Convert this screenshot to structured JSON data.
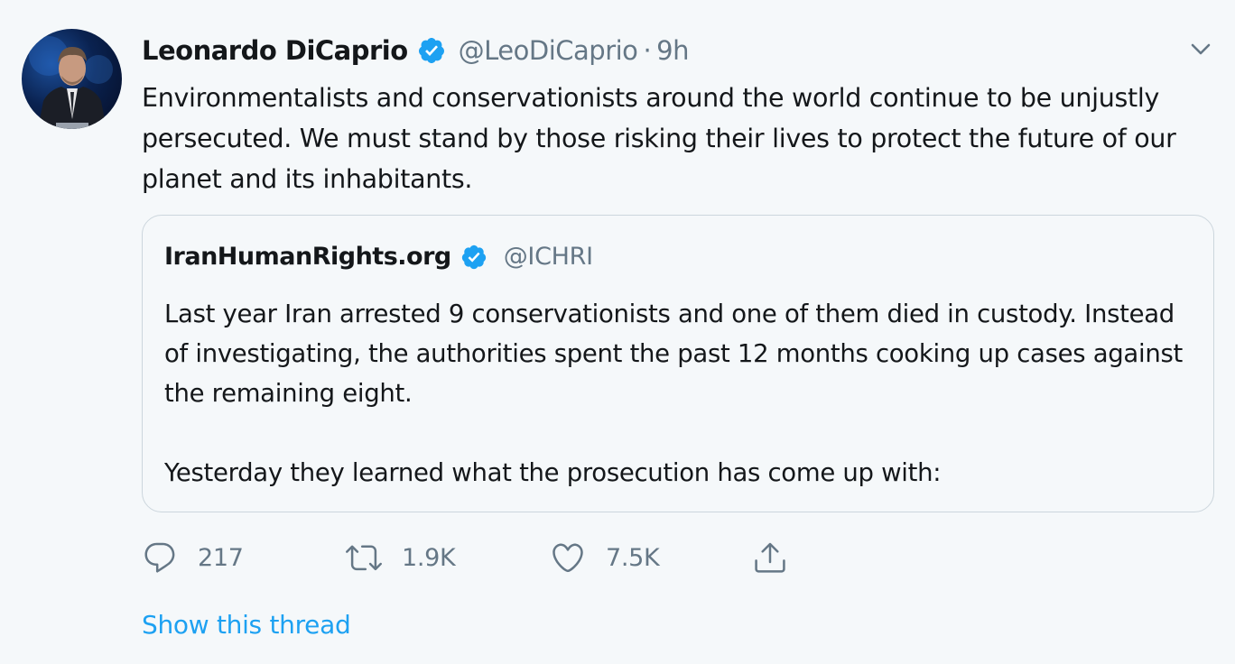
{
  "tweet": {
    "author": {
      "name": "Leonardo DiCaprio",
      "handle": "@LeoDiCaprio",
      "separator": "·",
      "time": "9h",
      "verified": true
    },
    "text": "Environmentalists and conservationists around the world continue to be unjustly persecuted. We must stand by those risking their lives to protect the future of our planet and its inhabitants.",
    "quoted": {
      "name": "IranHumanRights.org",
      "handle": "@ICHRI",
      "verified": true,
      "paragraph1": "Last year Iran arrested 9 conservationists and one of them died in custody. Instead of investigating, the authorities spent the past 12 months cooking up cases against the remaining eight.",
      "paragraph2": "Yesterday they learned what the prosecution has come up with:"
    },
    "actions": {
      "reply_count": "217",
      "retweet_count": "1.9K",
      "like_count": "7.5K"
    },
    "show_thread": "Show this thread"
  },
  "colors": {
    "background": "#f5f8fa",
    "text": "#14171a",
    "secondary": "#657786",
    "accent": "#1da1f2",
    "border": "#ccd6dd"
  },
  "icons": {
    "verified": "verified-badge-icon",
    "caret": "chevron-down-icon",
    "reply": "reply-icon",
    "retweet": "retweet-icon",
    "like": "heart-icon",
    "share": "share-icon"
  }
}
